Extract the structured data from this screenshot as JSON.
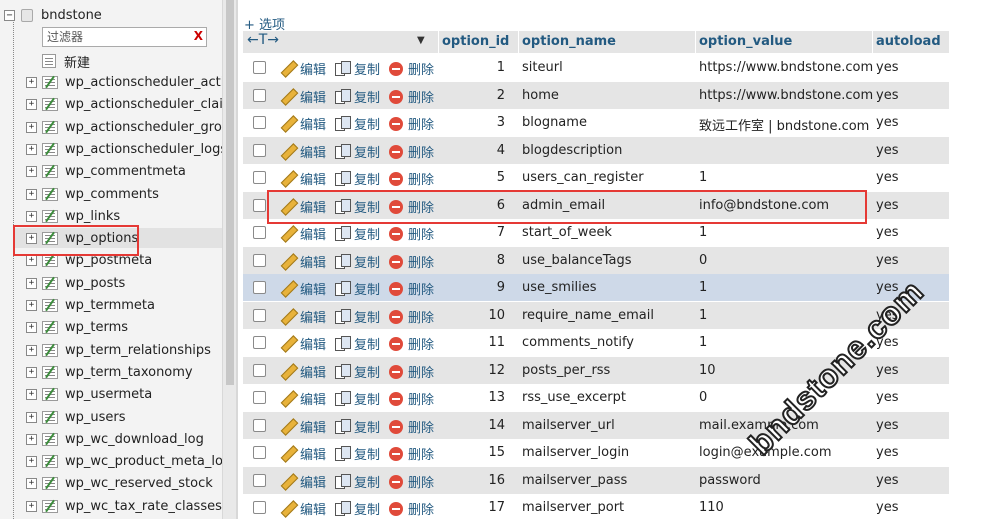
{
  "sidebar": {
    "database": "bndstone",
    "filter_placeholder": "过滤器",
    "filter_clear": "X",
    "new_label": "新建",
    "tables": [
      "wp_actionscheduler_actions",
      "wp_actionscheduler_claims",
      "wp_actionscheduler_groups",
      "wp_actionscheduler_logs",
      "wp_commentmeta",
      "wp_comments",
      "wp_links",
      "wp_options",
      "wp_postmeta",
      "wp_posts",
      "wp_termmeta",
      "wp_terms",
      "wp_term_relationships",
      "wp_term_taxonomy",
      "wp_usermeta",
      "wp_users",
      "wp_wc_download_log",
      "wp_wc_product_meta_lookup",
      "wp_wc_reserved_stock",
      "wp_wc_tax_rate_classes"
    ],
    "selected_table": "wp_options"
  },
  "main": {
    "options_toggle": "+ 选项",
    "header": {
      "arrows": "←T→",
      "sort_icon": "▼",
      "columns": [
        "option_id",
        "option_name",
        "option_value",
        "autoload"
      ]
    },
    "actions": {
      "edit": "编辑",
      "copy": "复制",
      "delete": "删除"
    },
    "rows": [
      {
        "id": "1",
        "name": "siteurl",
        "value": "https://www.bndstone.com",
        "autoload": "yes"
      },
      {
        "id": "2",
        "name": "home",
        "value": "https://www.bndstone.com",
        "autoload": "yes"
      },
      {
        "id": "3",
        "name": "blogname",
        "value": "致远工作室 | bndstone.com",
        "autoload": "yes"
      },
      {
        "id": "4",
        "name": "blogdescription",
        "value": "",
        "autoload": "yes"
      },
      {
        "id": "5",
        "name": "users_can_register",
        "value": "1",
        "autoload": "yes"
      },
      {
        "id": "6",
        "name": "admin_email",
        "value": "info@bndstone.com",
        "autoload": "yes"
      },
      {
        "id": "7",
        "name": "start_of_week",
        "value": "1",
        "autoload": "yes"
      },
      {
        "id": "8",
        "name": "use_balanceTags",
        "value": "0",
        "autoload": "yes"
      },
      {
        "id": "9",
        "name": "use_smilies",
        "value": "1",
        "autoload": "yes"
      },
      {
        "id": "10",
        "name": "require_name_email",
        "value": "1",
        "autoload": "yes"
      },
      {
        "id": "11",
        "name": "comments_notify",
        "value": "1",
        "autoload": "yes"
      },
      {
        "id": "12",
        "name": "posts_per_rss",
        "value": "10",
        "autoload": "yes"
      },
      {
        "id": "13",
        "name": "rss_use_excerpt",
        "value": "0",
        "autoload": "yes"
      },
      {
        "id": "14",
        "name": "mailserver_url",
        "value": "mail.example.com",
        "autoload": "yes"
      },
      {
        "id": "15",
        "name": "mailserver_login",
        "value": "login@example.com",
        "autoload": "yes"
      },
      {
        "id": "16",
        "name": "mailserver_pass",
        "value": "password",
        "autoload": "yes"
      },
      {
        "id": "17",
        "name": "mailserver_port",
        "value": "110",
        "autoload": "yes"
      }
    ],
    "hover_row": "9",
    "highlighted_row": "6"
  },
  "watermark": "bndstone.com",
  "colors": {
    "link": "#235a81",
    "highlight_box": "#e53935",
    "hover_row": "#ced9e8",
    "even_row": "#e5e5e5"
  }
}
